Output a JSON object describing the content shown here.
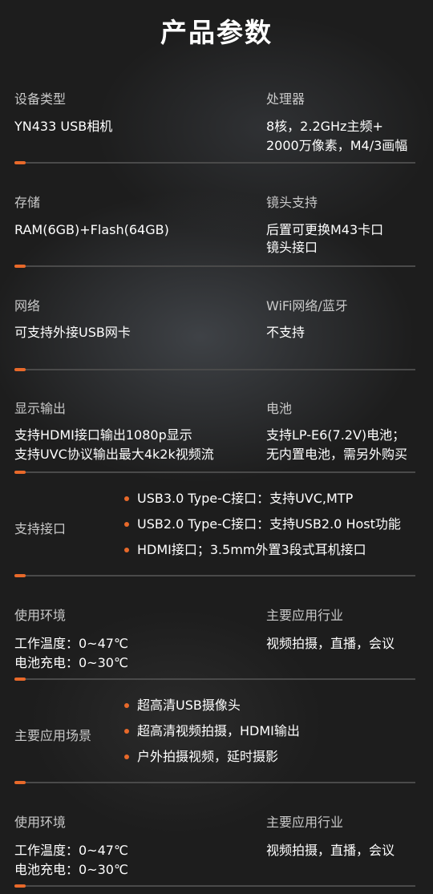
{
  "title": "产品参数",
  "accent_color": "#e8692a",
  "rows": [
    {
      "left_label": "设备类型",
      "left_value": [
        "YN433 USB相机"
      ],
      "right_label": "处理器",
      "right_value": [
        "8核，2.2GHz主频+",
        "2000万像素，M4/3画幅"
      ]
    },
    {
      "left_label": "存储",
      "left_value": [
        "RAM(6GB)+Flash(64GB)"
      ],
      "right_label": "镜头支持",
      "right_value": [
        "后置可更换M43卡口",
        "镜头接口"
      ]
    },
    {
      "left_label": "网络",
      "left_value": [
        "可支持外接USB网卡"
      ],
      "right_label": "WiFi网络/蓝牙",
      "right_value": [
        "不支持"
      ]
    },
    {
      "left_label": "显示输出",
      "left_value": [
        "支持HDMI接口输出1080p显示",
        "支持UVC协议输出最大4k2k视频流"
      ],
      "right_label": "电池",
      "right_value": [
        "支持LP-E6(7.2V)电池；",
        "无内置电池，需另外购买"
      ]
    }
  ],
  "interface": {
    "label": "支持接口",
    "items": [
      "USB3.0 Type-C接口：支持UVC,MTP",
      "USB2.0 Type-C接口：支持USB2.0 Host功能",
      "HDMI接口；3.5mm外置3段式耳机接口"
    ]
  },
  "env1": {
    "left_label": "使用环境",
    "left_value": [
      "工作温度：0~47℃",
      "电池充电：0~30℃"
    ],
    "right_label": "主要应用行业",
    "right_value": [
      "视频拍摄，直播，会议"
    ]
  },
  "scenes": {
    "label": "主要应用场景",
    "items": [
      "超高清USB摄像头",
      "超高清视频拍摄，HDMI输出",
      "户外拍摄视频，延时摄影"
    ]
  },
  "env2": {
    "left_label": "使用环境",
    "left_value": [
      "工作温度：0~47℃",
      "电池充电：0~30℃"
    ],
    "right_label": "主要应用行业",
    "right_value": [
      "视频拍摄，直播，会议"
    ]
  }
}
